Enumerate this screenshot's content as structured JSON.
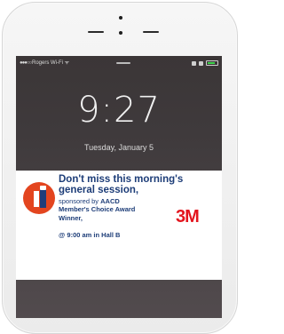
{
  "statusbar": {
    "signal": "●●●○○",
    "carrier": "Rogers Wi-Fi ᯤ",
    "battery_color": "#3cd34a"
  },
  "lockscreen": {
    "time": "9:27",
    "date": "Tuesday, January 5"
  },
  "notification": {
    "headline": "Don't miss this morning's general session,",
    "sponsor_prefix": "sponsored by",
    "sponsor_name": "AACD",
    "award": "Member's Choice Award Winner,",
    "when_where": "@ 9:00 am in Hall B",
    "brand": "3M",
    "colors": {
      "text": "#1d3d78",
      "icon_bg": "#e3451f",
      "brand": "#e3151e"
    }
  }
}
